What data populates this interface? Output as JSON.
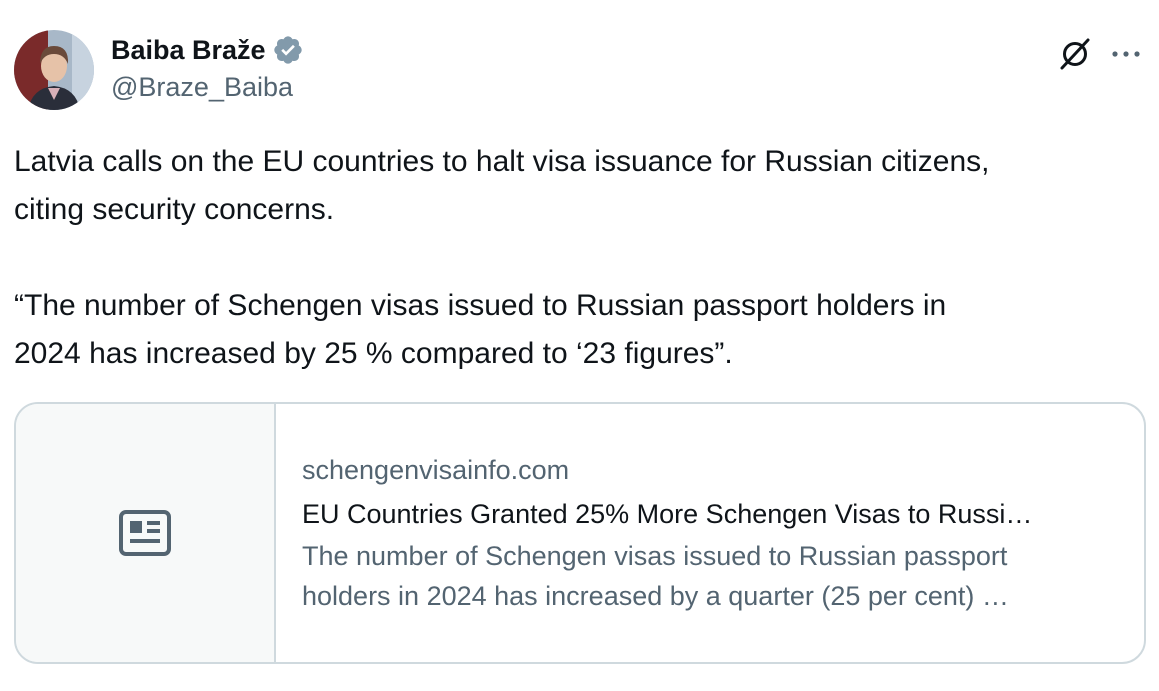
{
  "author": {
    "name": "Baiba Braže",
    "handle": "@Braze_Baiba",
    "verified_color": "#829aab",
    "avatar": "avatar"
  },
  "actions": {
    "grok_icon": "grok-slash-circle-icon",
    "more_icon": "more-horizontal-icon"
  },
  "tweet": {
    "line1": "Latvia calls on the EU countries to halt visa issuance for Russian citizens,",
    "line2": "citing security concerns.",
    "line3": "“The number of Schengen visas issued to Russian passport holders in",
    "line4": "2024 has increased by 25 % compared to ‘23 figures”."
  },
  "link_card": {
    "icon": "article-icon",
    "domain": "schengenvisainfo.com",
    "title": "EU Countries Granted 25% More Schengen Visas to Russi…",
    "desc_line1": "The number of Schengen visas issued to Russian passport",
    "desc_line2": "holders in 2024 has increased by a quarter (25 per cent) …"
  },
  "colors": {
    "text": "#0f1419",
    "secondary": "#536471",
    "border": "#cfd9de",
    "card_thumb_bg": "#f7f9f9"
  }
}
